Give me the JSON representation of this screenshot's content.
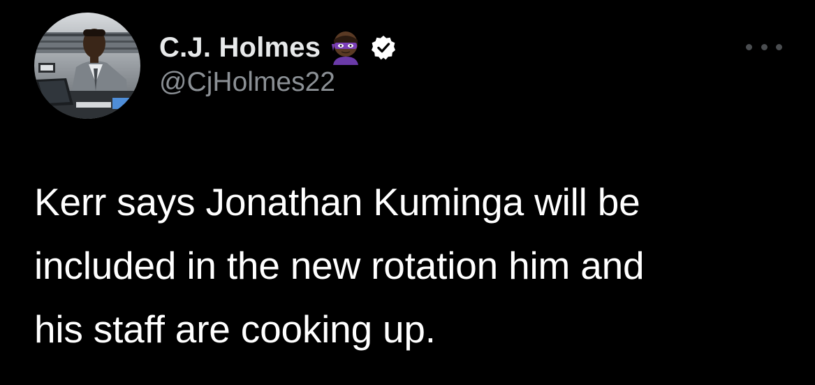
{
  "author": {
    "display_name": "C.J. Holmes",
    "handle": "@CjHolmes22",
    "name_emoji": "ninja-emoji",
    "verified_badge": "verified-icon"
  },
  "tweet": {
    "text_lines": [
      "Kerr says Jonathan Kuminga will be",
      "included in the new rotation him and",
      "his staff are cooking up."
    ]
  },
  "menu": {
    "icon": "more-icon"
  },
  "colors": {
    "background": "#000000",
    "text": "#ffffff",
    "secondary_text": "#8b9095",
    "verified_badge": "#ffffff"
  }
}
